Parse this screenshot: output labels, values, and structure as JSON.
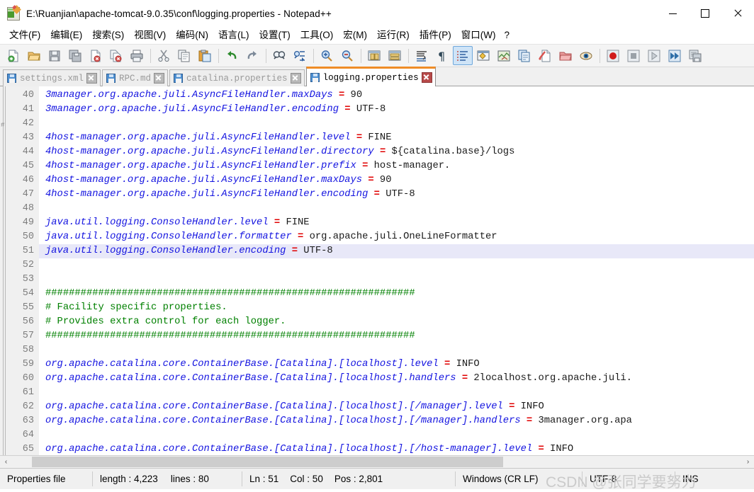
{
  "window": {
    "title": "E:\\Ruanjian\\apache-tomcat-9.0.35\\conf\\logging.properties - Notepad++",
    "icon": "notepad-plus-plus-icon",
    "minimize": "—",
    "maximize": "□",
    "close": "✕"
  },
  "menu": {
    "items": [
      {
        "label": "文件(F)"
      },
      {
        "label": "编辑(E)"
      },
      {
        "label": "搜索(S)"
      },
      {
        "label": "视图(V)"
      },
      {
        "label": "编码(N)"
      },
      {
        "label": "语言(L)"
      },
      {
        "label": "设置(T)"
      },
      {
        "label": "工具(O)"
      },
      {
        "label": "宏(M)"
      },
      {
        "label": "运行(R)"
      },
      {
        "label": "插件(P)"
      },
      {
        "label": "窗口(W)"
      },
      {
        "label": "?"
      }
    ]
  },
  "toolbar": {
    "buttons": [
      {
        "name": "new-file-icon"
      },
      {
        "name": "open-file-icon"
      },
      {
        "name": "save-icon"
      },
      {
        "name": "save-all-icon"
      },
      {
        "name": "close-file-icon"
      },
      {
        "name": "close-all-files-icon"
      },
      {
        "name": "print-icon"
      },
      {
        "name": "separator"
      },
      {
        "name": "cut-icon"
      },
      {
        "name": "copy-icon"
      },
      {
        "name": "paste-icon"
      },
      {
        "name": "separator"
      },
      {
        "name": "undo-icon"
      },
      {
        "name": "redo-icon"
      },
      {
        "name": "separator"
      },
      {
        "name": "find-icon"
      },
      {
        "name": "replace-icon"
      },
      {
        "name": "separator"
      },
      {
        "name": "zoom-in-icon"
      },
      {
        "name": "zoom-out-icon"
      },
      {
        "name": "separator"
      },
      {
        "name": "sync-vertical-scroll-icon"
      },
      {
        "name": "sync-horizontal-scroll-icon"
      },
      {
        "name": "separator"
      },
      {
        "name": "word-wrap-icon"
      },
      {
        "name": "show-all-characters-icon"
      },
      {
        "name": "indent-guide-icon",
        "active": true
      },
      {
        "name": "user-defined-dialog-icon"
      },
      {
        "name": "document-map-icon"
      },
      {
        "name": "function-list-icon"
      },
      {
        "name": "document-switcher-icon"
      },
      {
        "name": "folder-as-workspace-icon"
      },
      {
        "name": "monitoring-icon"
      },
      {
        "name": "separator"
      },
      {
        "name": "record-macro-icon"
      },
      {
        "name": "stop-recording-macro-icon"
      },
      {
        "name": "play-macro-icon"
      },
      {
        "name": "run-macro-multiple-times-icon"
      },
      {
        "name": "save-current-macro-icon"
      }
    ]
  },
  "tabs": [
    {
      "label": "settings.xml",
      "active": false
    },
    {
      "label": "RPC.md",
      "active": false
    },
    {
      "label": "catalina.properties",
      "active": false
    },
    {
      "label": "logging.properties",
      "active": true
    }
  ],
  "editor": {
    "current_line": 51,
    "first_visible_line": 40,
    "lines": [
      {
        "n": 40,
        "segments": [
          {
            "t": "3manager.org.apache.juli.AsyncFileHandler.maxDays ",
            "c": "k"
          },
          {
            "t": "=",
            "c": "eq"
          },
          {
            "t": " 90",
            "c": "v"
          }
        ]
      },
      {
        "n": 41,
        "segments": [
          {
            "t": "3manager.org.apache.juli.AsyncFileHandler.encoding ",
            "c": "k"
          },
          {
            "t": "=",
            "c": "eq"
          },
          {
            "t": " UTF-8",
            "c": "v"
          }
        ]
      },
      {
        "n": 42,
        "segments": []
      },
      {
        "n": 43,
        "segments": [
          {
            "t": "4host-manager.org.apache.juli.AsyncFileHandler.level ",
            "c": "k"
          },
          {
            "t": "=",
            "c": "eq"
          },
          {
            "t": " FINE",
            "c": "v"
          }
        ]
      },
      {
        "n": 44,
        "segments": [
          {
            "t": "4host-manager.org.apache.juli.AsyncFileHandler.directory ",
            "c": "k"
          },
          {
            "t": "=",
            "c": "eq"
          },
          {
            "t": " ${catalina.base}/logs",
            "c": "v"
          }
        ]
      },
      {
        "n": 45,
        "segments": [
          {
            "t": "4host-manager.org.apache.juli.AsyncFileHandler.prefix ",
            "c": "k"
          },
          {
            "t": "=",
            "c": "eq"
          },
          {
            "t": " host-manager.",
            "c": "v"
          }
        ]
      },
      {
        "n": 46,
        "segments": [
          {
            "t": "4host-manager.org.apache.juli.AsyncFileHandler.maxDays ",
            "c": "k"
          },
          {
            "t": "=",
            "c": "eq"
          },
          {
            "t": " 90",
            "c": "v"
          }
        ]
      },
      {
        "n": 47,
        "segments": [
          {
            "t": "4host-manager.org.apache.juli.AsyncFileHandler.encoding ",
            "c": "k"
          },
          {
            "t": "=",
            "c": "eq"
          },
          {
            "t": " UTF-8",
            "c": "v"
          }
        ]
      },
      {
        "n": 48,
        "segments": []
      },
      {
        "n": 49,
        "segments": [
          {
            "t": "java.util.logging.ConsoleHandler.level ",
            "c": "k"
          },
          {
            "t": "=",
            "c": "eq"
          },
          {
            "t": " FINE",
            "c": "v"
          }
        ]
      },
      {
        "n": 50,
        "segments": [
          {
            "t": "java.util.logging.ConsoleHandler.formatter ",
            "c": "k"
          },
          {
            "t": "=",
            "c": "eq"
          },
          {
            "t": " org.apache.juli.OneLineFormatter",
            "c": "v"
          }
        ]
      },
      {
        "n": 51,
        "highlight": true,
        "segments": [
          {
            "t": "java.util.logging.ConsoleHandler.encoding ",
            "c": "k"
          },
          {
            "t": "=",
            "c": "eq"
          },
          {
            "t": " UTF-8",
            "c": "v"
          }
        ]
      },
      {
        "n": 52,
        "segments": []
      },
      {
        "n": 53,
        "segments": []
      },
      {
        "n": 54,
        "segments": [
          {
            "t": "###############################################################",
            "c": "cm"
          }
        ]
      },
      {
        "n": 55,
        "segments": [
          {
            "t": "# Facility specific properties.",
            "c": "cm"
          }
        ]
      },
      {
        "n": 56,
        "segments": [
          {
            "t": "# Provides extra control for each logger.",
            "c": "cm"
          }
        ]
      },
      {
        "n": 57,
        "segments": [
          {
            "t": "###############################################################",
            "c": "cm"
          }
        ]
      },
      {
        "n": 58,
        "segments": []
      },
      {
        "n": 59,
        "segments": [
          {
            "t": "org.apache.catalina.core.ContainerBase.[Catalina].[localhost].level ",
            "c": "k"
          },
          {
            "t": "=",
            "c": "eq"
          },
          {
            "t": " INFO",
            "c": "v"
          }
        ]
      },
      {
        "n": 60,
        "segments": [
          {
            "t": "org.apache.catalina.core.ContainerBase.[Catalina].[localhost].handlers ",
            "c": "k"
          },
          {
            "t": "=",
            "c": "eq"
          },
          {
            "t": " 2localhost.org.apache.juli.",
            "c": "v"
          }
        ]
      },
      {
        "n": 61,
        "segments": []
      },
      {
        "n": 62,
        "segments": [
          {
            "t": "org.apache.catalina.core.ContainerBase.[Catalina].[localhost].[/manager].level ",
            "c": "k"
          },
          {
            "t": "=",
            "c": "eq"
          },
          {
            "t": " INFO",
            "c": "v"
          }
        ]
      },
      {
        "n": 63,
        "segments": [
          {
            "t": "org.apache.catalina.core.ContainerBase.[Catalina].[localhost].[/manager].handlers ",
            "c": "k"
          },
          {
            "t": "=",
            "c": "eq"
          },
          {
            "t": " 3manager.org.apa",
            "c": "v"
          }
        ]
      },
      {
        "n": 64,
        "segments": []
      },
      {
        "n": 65,
        "segments": [
          {
            "t": "org.apache.catalina.core.ContainerBase.[Catalina].[localhost].[/host-manager].level ",
            "c": "k"
          },
          {
            "t": "=",
            "c": "eq"
          },
          {
            "t": " INFO",
            "c": "v"
          }
        ]
      }
    ]
  },
  "hscroll": {
    "left_arrow": "‹",
    "right_arrow": "›"
  },
  "status": {
    "doc_type": "Properties file",
    "length_label": "length : 4,223",
    "lines_label": "lines : 80",
    "ln": "Ln : 51",
    "col": "Col : 50",
    "pos": "Pos : 2,801",
    "eol": "Windows (CR LF)",
    "encoding": "UTF-8",
    "insert_mode": "INS",
    "watermark": "CSDN @张同学要努力"
  },
  "colors": {
    "accent_tab": "#ef8c27",
    "keyword": "#1414e0",
    "operator": "#e00000",
    "comment": "#008000",
    "current_line": "#e8e8f8"
  }
}
